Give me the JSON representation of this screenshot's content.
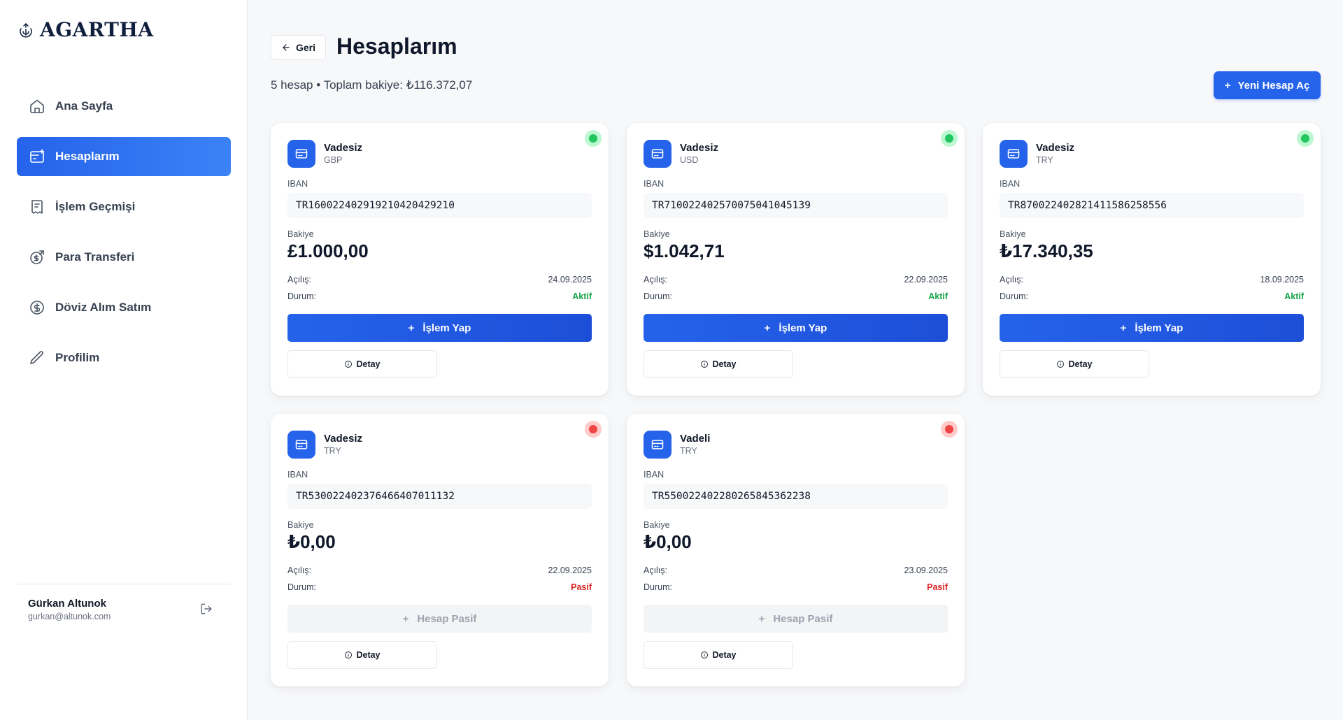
{
  "app": {
    "logo_text": "AGARTHA"
  },
  "sidebar": {
    "items": [
      {
        "label": "Ana Sayfa",
        "icon": "home-icon"
      },
      {
        "label": "Hesaplarım",
        "icon": "wallet-icon"
      },
      {
        "label": "İşlem Geçmişi",
        "icon": "receipt-icon"
      },
      {
        "label": "Para Transferi",
        "icon": "transfer-icon"
      },
      {
        "label": "Döviz Alım Satım",
        "icon": "dollar-icon"
      },
      {
        "label": "Profilim",
        "icon": "pencil-icon"
      }
    ],
    "active_index": 1,
    "user": {
      "name": "Gürkan Altunok",
      "email": "gurkan@altunok.com"
    }
  },
  "header": {
    "back_label": "Geri",
    "title": "Hesaplarım",
    "summary": "5 hesap • Toplam bakiye: ₺116.372,07",
    "new_account_label": "Yeni Hesap Aç"
  },
  "labels": {
    "iban": "IBAN",
    "balance": "Bakiye",
    "opened": "Açılış:",
    "status": "Durum:",
    "detail": "Detay"
  },
  "accounts": [
    {
      "type": "Vadesiz",
      "currency": "GBP",
      "iban": "TR160022402919210420429210",
      "balance": "£1.000,00",
      "opened": "24.09.2025",
      "status": "Aktif",
      "active": true,
      "action_label": "İşlem Yap"
    },
    {
      "type": "Vadesiz",
      "currency": "USD",
      "iban": "TR710022402570075041045139",
      "balance": "$1.042,71",
      "opened": "22.09.2025",
      "status": "Aktif",
      "active": true,
      "action_label": "İşlem Yap"
    },
    {
      "type": "Vadesiz",
      "currency": "TRY",
      "iban": "TR870022402821411586258556",
      "balance": "₺17.340,35",
      "opened": "18.09.2025",
      "status": "Aktif",
      "active": true,
      "action_label": "İşlem Yap"
    },
    {
      "type": "Vadesiz",
      "currency": "TRY",
      "iban": "TR530022402376466407011132",
      "balance": "₺0,00",
      "opened": "22.09.2025",
      "status": "Pasif",
      "active": false,
      "action_label": "Hesap Pasif"
    },
    {
      "type": "Vadeli",
      "currency": "TRY",
      "iban": "TR550022402280265845362238",
      "balance": "₺0,00",
      "opened": "23.09.2025",
      "status": "Pasif",
      "active": false,
      "action_label": "Hesap Pasif"
    }
  ],
  "colors": {
    "accent": "#2563eb",
    "active_status": "#16a34a",
    "passive_status": "#dc2626"
  }
}
